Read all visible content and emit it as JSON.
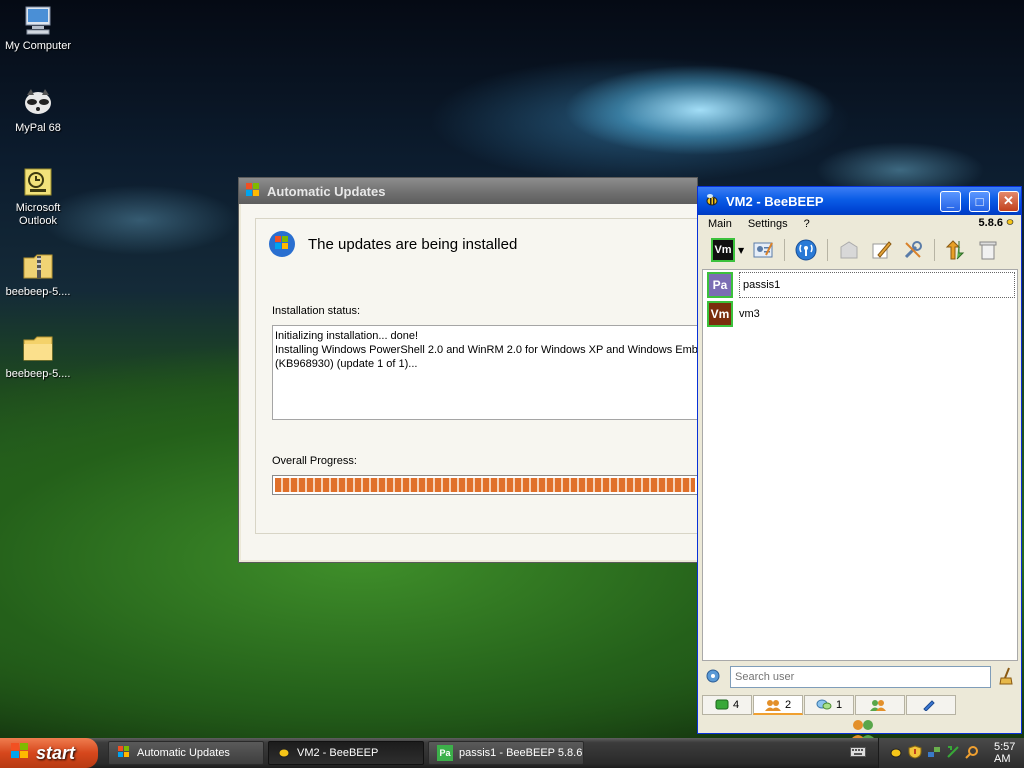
{
  "desktop": {
    "icons": [
      {
        "label": "My Computer",
        "icon": "computer-icon"
      },
      {
        "label": "MyPal 68",
        "icon": "raccoon-browser-icon"
      },
      {
        "label": "Microsoft Outlook",
        "icon": "outlook-icon"
      },
      {
        "label": "beebeep-5....",
        "icon": "zip-folder-icon"
      },
      {
        "label": "beebeep-5....",
        "icon": "folder-icon"
      }
    ]
  },
  "au_window": {
    "title": "Automatic Updates",
    "heading": "The updates are being installed",
    "status_label": "Installation status:",
    "status_text": "Initializing installation... done!\nInstalling Windows PowerShell 2.0 and WinRM 2.0 for Windows XP and Windows Embedded\n(KB968930) (update 1 of 1)...",
    "progress_label": "Overall Progress:",
    "progress_fraction": 1.0
  },
  "beebeep": {
    "title": "VM2 - BeeBEEP",
    "menu": [
      "Main",
      "Settings",
      "?"
    ],
    "version": "5.8.6",
    "status_avatar": "Vm",
    "users": [
      {
        "initials": "Pa",
        "name": "passis1",
        "color": "#7b6db4"
      },
      {
        "initials": "Vm",
        "name": "vm3",
        "color": "#7a2d0c"
      }
    ],
    "search_placeholder": "Search user",
    "tabs": [
      {
        "icon": "chat-green-icon",
        "count": "4"
      },
      {
        "icon": "users-icon",
        "count": "2"
      },
      {
        "icon": "chat-bubbles-icon",
        "count": "1"
      },
      {
        "icon": "group-icon",
        "count": ""
      },
      {
        "icon": "file-share-icon",
        "count": ""
      }
    ]
  },
  "taskbar": {
    "start_label": "start",
    "buttons": [
      {
        "label": "Automatic Updates"
      },
      {
        "label": "VM2 - BeeBEEP"
      },
      {
        "label": "passis1 - BeeBEEP 5.8.6",
        "badge": "Pa"
      }
    ],
    "clock": "5:57 AM"
  }
}
